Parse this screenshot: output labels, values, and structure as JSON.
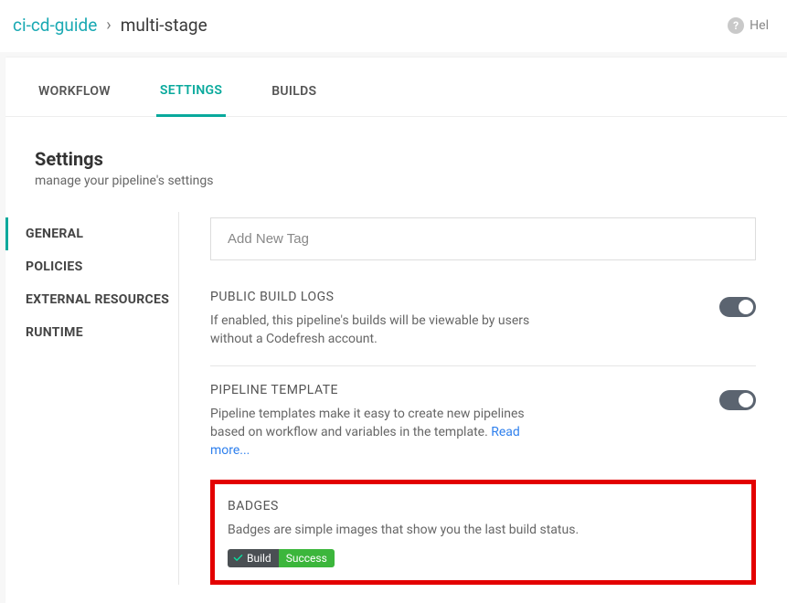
{
  "breadcrumb": {
    "project": "ci-cd-guide",
    "current": "multi-stage"
  },
  "help_label": "Hel",
  "tabs": {
    "workflow": "WORKFLOW",
    "settings": "SETTINGS",
    "builds": "BUILDS"
  },
  "header": {
    "title": "Settings",
    "subtitle": "manage your pipeline's settings"
  },
  "sidenav": {
    "general": "GENERAL",
    "policies": "POLICIES",
    "external_resources": "EXTERNAL RESOURCES",
    "runtime": "RUNTIME"
  },
  "tag_input_placeholder": "Add New Tag",
  "sections": {
    "public_logs": {
      "title": "PUBLIC BUILD LOGS",
      "desc": "If enabled, this pipeline's builds will be viewable by users without a Codefresh account."
    },
    "template": {
      "title": "PIPELINE TEMPLATE",
      "desc_a": "Pipeline templates make it easy to create new pipelines based on workflow and variables in the template. ",
      "read_more": "Read more..."
    },
    "badges": {
      "title": "BADGES",
      "desc": "Badges are simple images that show you the last build status.",
      "pill_left": "Build",
      "pill_right": "Success"
    }
  }
}
